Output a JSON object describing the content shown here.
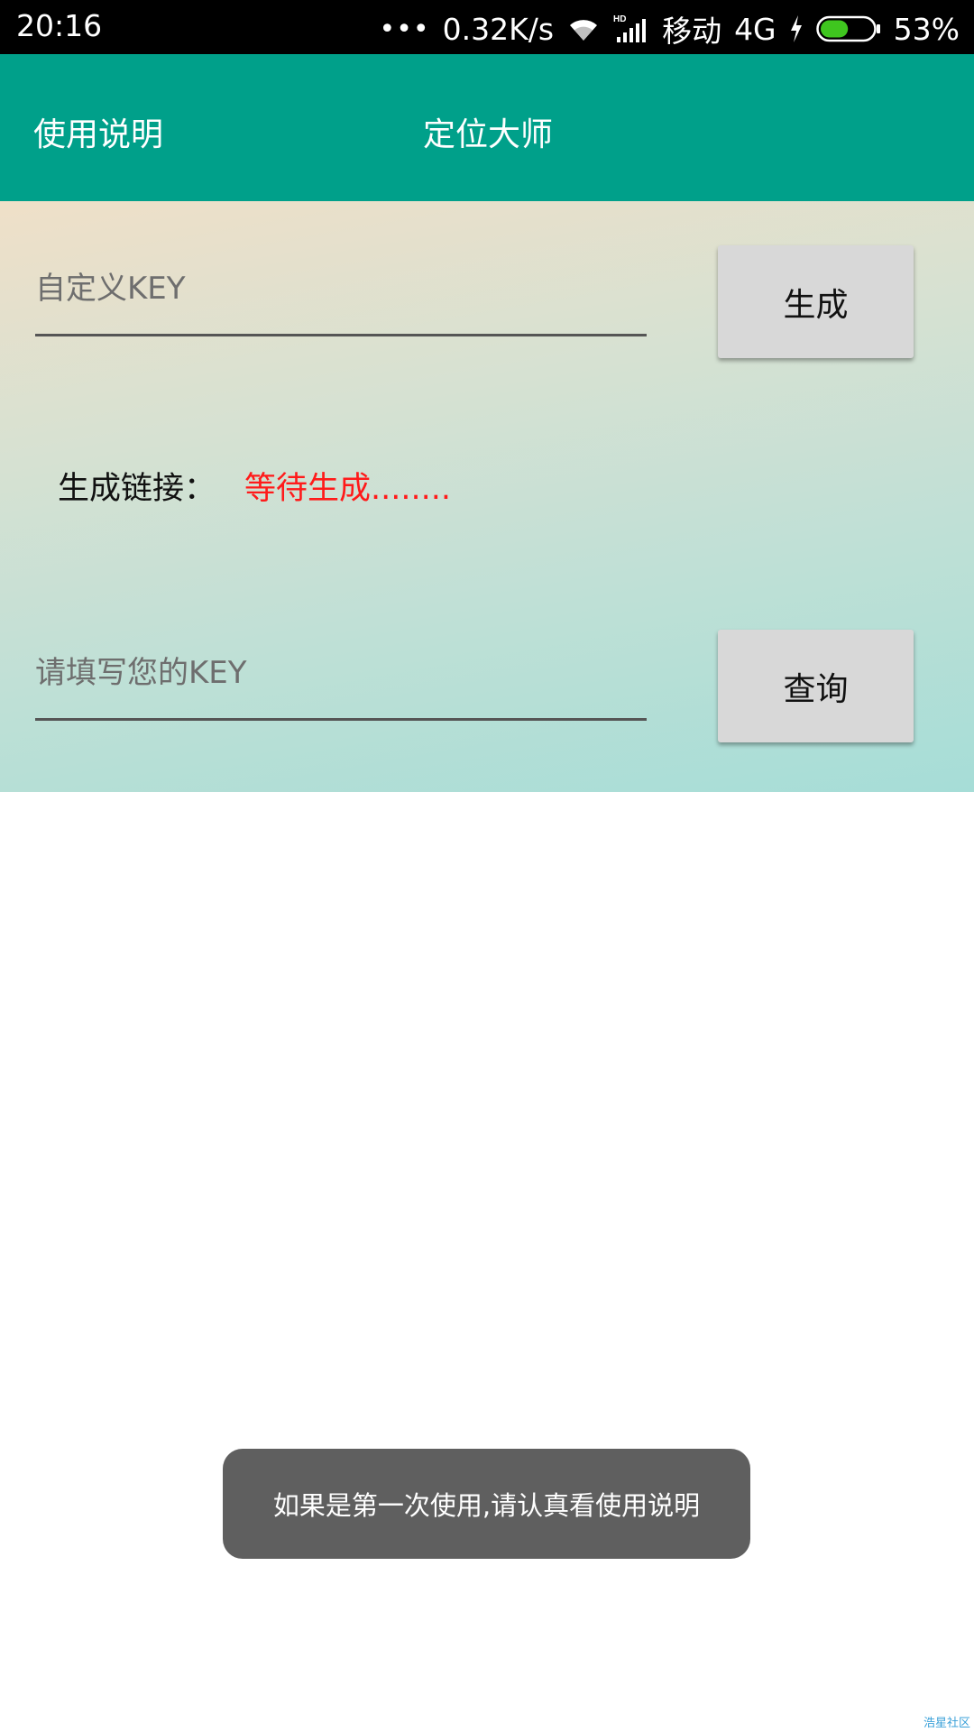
{
  "status_bar": {
    "time": "20:16",
    "dots": "•••",
    "speed": "0.32K/s",
    "carrier": "移动",
    "network": "4G",
    "battery": "53%",
    "battery_level": 0.53,
    "battery_color": "#3fc61f"
  },
  "app_bar": {
    "help_label": "使用说明",
    "title": "定位大师",
    "color": "#00a08a"
  },
  "form": {
    "key_placeholder": "自定义KEY",
    "generate_label": "生成",
    "link_label": "生成链接：",
    "link_value": "等待生成........",
    "query_placeholder": "请填写您的KEY",
    "query_label": "查询"
  },
  "toast": {
    "message": "如果是第一次使用,请认真看使用说明"
  },
  "watermark": "浩星社区"
}
